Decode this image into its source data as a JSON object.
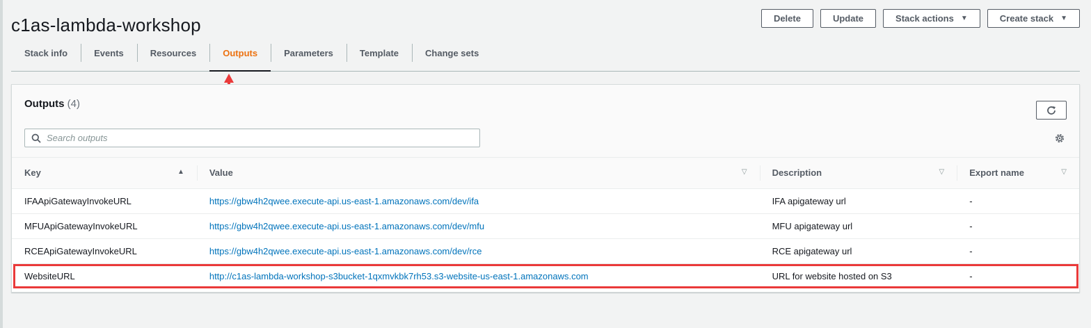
{
  "stack": {
    "title": "c1as-lambda-workshop"
  },
  "actions": {
    "delete": "Delete",
    "update": "Update",
    "stack_actions": "Stack actions",
    "create_stack": "Create stack"
  },
  "tabs": [
    {
      "label": "Stack info"
    },
    {
      "label": "Events"
    },
    {
      "label": "Resources"
    },
    {
      "label": "Outputs"
    },
    {
      "label": "Parameters"
    },
    {
      "label": "Template"
    },
    {
      "label": "Change sets"
    }
  ],
  "active_tab": "Outputs",
  "outputs": {
    "title": "Outputs",
    "count": "(4)",
    "search_placeholder": "Search outputs",
    "columns": {
      "key": "Key",
      "value": "Value",
      "description": "Description",
      "export_name": "Export name"
    },
    "rows": [
      {
        "key": "IFAApiGatewayInvokeURL",
        "value": "https://gbw4h2qwee.execute-api.us-east-1.amazonaws.com/dev/ifa",
        "description": "IFA apigateway url",
        "export_name": "-"
      },
      {
        "key": "MFUApiGatewayInvokeURL",
        "value": "https://gbw4h2qwee.execute-api.us-east-1.amazonaws.com/dev/mfu",
        "description": "MFU apigateway url",
        "export_name": "-"
      },
      {
        "key": "RCEApiGatewayInvokeURL",
        "value": "https://gbw4h2qwee.execute-api.us-east-1.amazonaws.com/dev/rce",
        "description": "RCE apigateway url",
        "export_name": "-"
      },
      {
        "key": "WebsiteURL",
        "value": "http://c1as-lambda-workshop-s3bucket-1qxmvkbk7rh53.s3-website-us-east-1.amazonaws.com",
        "description": "URL for website hosted on S3",
        "export_name": "-"
      }
    ]
  },
  "colors": {
    "accent": "#ec7211",
    "link": "#0073bb",
    "annotation": "#ea3a3a"
  },
  "icons": {
    "refresh": "refresh-icon",
    "search": "search-icon",
    "settings": "gear-icon",
    "sort_asc": "sort-ascending-icon",
    "filter": "sort-filter-icon",
    "dropdown": "caret-down-icon"
  }
}
